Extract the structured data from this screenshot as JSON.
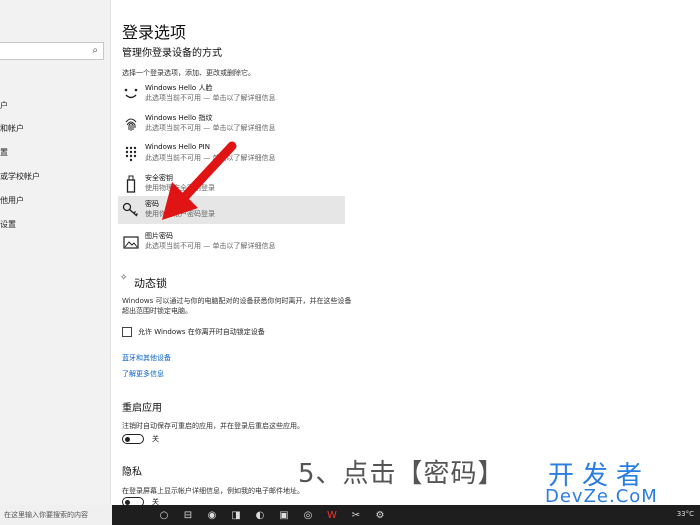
{
  "sidebar": {
    "items": [
      {
        "label": "户"
      },
      {
        "label": "和帐户"
      },
      {
        "label": "置"
      },
      {
        "label": "或学校帐户"
      },
      {
        "label": "他用户"
      },
      {
        "label": "设置"
      }
    ]
  },
  "main": {
    "title": "登录选项",
    "subtitle": "管理你登录设备的方式",
    "help": "选择一个登录选项，添加、更改或删除它。",
    "options": [
      {
        "name": "Windows Hello 人脸",
        "desc": "此选项当前不可用 — 单击以了解详细信息",
        "icon": "face-icon"
      },
      {
        "name": "Windows Hello 指纹",
        "desc": "此选项当前不可用 — 单击以了解详细信息",
        "icon": "fingerprint-icon"
      },
      {
        "name": "Windows Hello PIN",
        "desc": "此选项当前不可用 — 单击以了解详细信息",
        "icon": "pin-keypad-icon"
      },
      {
        "name": "安全密钥",
        "desc": "使用物理安全密钥登录",
        "icon": "usb-key-icon"
      },
      {
        "name": "密码",
        "desc": "使用你的帐户密码登录",
        "icon": "key-icon"
      },
      {
        "name": "图片密码",
        "desc": "此选项当前不可用 — 单击以了解详细信息",
        "icon": "picture-icon"
      }
    ],
    "dynamic_lock": {
      "title": "动态锁",
      "text": "Windows 可以通过与你的电脑配对的设备获悉你何时离开，并在这些设备超出范围时锁定电脑。",
      "checkbox": "允许 Windows 在你离开时自动锁定设备",
      "link1": "蓝牙和其他设备",
      "link2": "了解更多信息"
    },
    "restart": {
      "title": "重启应用",
      "text": "注销时自动保存可重启的应用，并在登录后重启这些应用。",
      "toggle": "关"
    },
    "privacy": {
      "title": "隐私",
      "text": "在登录屏幕上显示帐户详细信息，例如我的电子邮件地址。",
      "toggle": "关"
    }
  },
  "overlay": {
    "step": "5、点击【密码】",
    "watermark_top": "开发者",
    "watermark_bottom": "DevZe.CoM"
  },
  "taskbar": {
    "search_placeholder": "在这里输入你要搜索的内容",
    "temperature": "33°C"
  },
  "colors": {
    "accent": "#0a62c8",
    "arrow": "#e01414",
    "watermark": "#2a7de1"
  }
}
